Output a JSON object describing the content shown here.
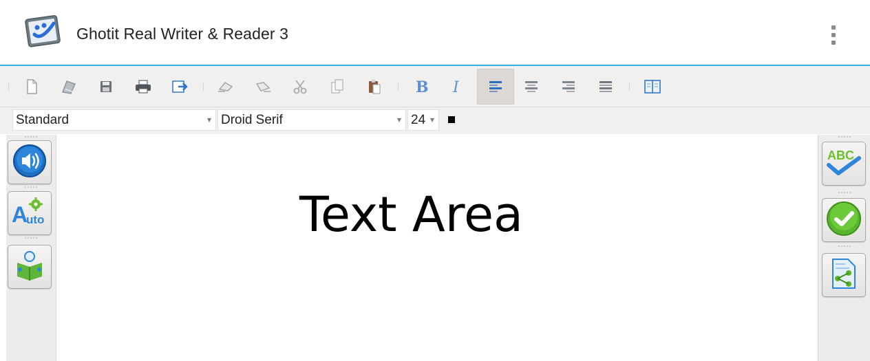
{
  "app": {
    "title": "Ghotit Real Writer & Reader 3",
    "logo_icon": "ghotit-logo-icon",
    "accent_color": "#33b5e5"
  },
  "toolbar": {
    "buttons": [
      {
        "name": "new-document-icon",
        "label": "New"
      },
      {
        "name": "open-document-icon",
        "label": "Open"
      },
      {
        "name": "save-icon",
        "label": "Save"
      },
      {
        "name": "print-icon",
        "label": "Print"
      },
      {
        "name": "export-icon",
        "label": "Export"
      },
      {
        "name": "undo-icon",
        "label": "Undo"
      },
      {
        "name": "redo-icon",
        "label": "Redo"
      },
      {
        "name": "cut-icon",
        "label": "Cut"
      },
      {
        "name": "copy-icon",
        "label": "Copy"
      },
      {
        "name": "paste-icon",
        "label": "Paste"
      },
      {
        "name": "bold-icon",
        "label": "B"
      },
      {
        "name": "italic-icon",
        "label": "I"
      },
      {
        "name": "align-left-icon",
        "label": "Align left",
        "active": true
      },
      {
        "name": "align-center-icon",
        "label": "Align center"
      },
      {
        "name": "align-right-icon",
        "label": "Align right"
      },
      {
        "name": "justify-icon",
        "label": "Justify"
      },
      {
        "name": "dictionary-icon",
        "label": "Dictionary"
      }
    ]
  },
  "format": {
    "style": "Standard",
    "font": "Droid Serif",
    "size": "24",
    "text_color": "#000000"
  },
  "left_panel": {
    "buttons": [
      "speaker-icon",
      "auto-icon",
      "reader-icon"
    ]
  },
  "right_panel": {
    "buttons": [
      "spell-check-abc-icon",
      "check-icon",
      "share-document-icon"
    ]
  },
  "document": {
    "text": "Text Area"
  }
}
